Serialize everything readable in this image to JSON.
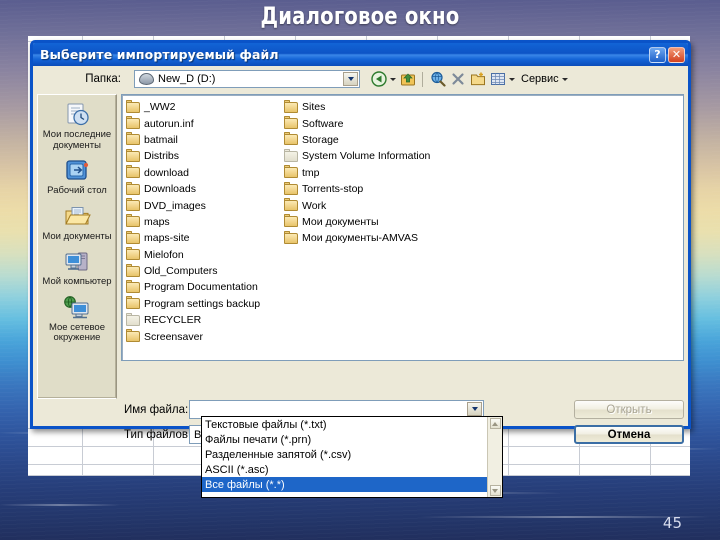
{
  "slide": {
    "title": "Диалоговое окно",
    "page_number": "45",
    "accent_color": "#0a53c8",
    "titlebar_color": "#0d54c6",
    "selection_color": "#1e66c8",
    "dialog_face_color": "#ece9d8"
  },
  "dialog": {
    "title": "Выберите импортируемый файл",
    "titlebar_buttons": [
      {
        "name": "help-button",
        "glyph": "?"
      },
      {
        "name": "close-button",
        "glyph": "✕"
      }
    ],
    "lookin": {
      "label": "Папка:",
      "value": "New_D (D:)",
      "icon": "drive-icon"
    },
    "toolbar": {
      "items": [
        {
          "name": "back-button",
          "icon": "back-arrow-icon"
        },
        {
          "name": "back-dropdown",
          "icon": "chevron-down-icon"
        },
        {
          "name": "up-one-level-button",
          "icon": "up-folder-icon"
        },
        {
          "name": "separator",
          "icon": "separator"
        },
        {
          "name": "search-button",
          "icon": "search-globe-icon"
        },
        {
          "name": "delete-button",
          "icon": "delete-x-icon"
        },
        {
          "name": "new-folder-button",
          "icon": "new-folder-icon"
        },
        {
          "name": "views-button",
          "icon": "views-grid-icon"
        },
        {
          "name": "views-dropdown",
          "icon": "chevron-down-icon"
        }
      ],
      "tools_label": "Сервис"
    },
    "places": [
      {
        "name": "my-recent-documents",
        "label": "Мои последние документы",
        "icon": "recent-documents-icon"
      },
      {
        "name": "desktop",
        "label": "Рабочий стол",
        "icon": "desktop-icon"
      },
      {
        "name": "my-documents",
        "label": "Мои документы",
        "icon": "my-documents-icon"
      },
      {
        "name": "my-computer",
        "label": "Мой компьютер",
        "icon": "my-computer-icon"
      },
      {
        "name": "my-network-places",
        "label": "Мое сетевое окружение",
        "icon": "network-places-icon"
      }
    ],
    "files": {
      "column1": [
        {
          "label": "_WW2",
          "type": "folder"
        },
        {
          "label": "autorun.inf",
          "type": "folder"
        },
        {
          "label": "batmail",
          "type": "folder"
        },
        {
          "label": "Distribs",
          "type": "folder"
        },
        {
          "label": "download",
          "type": "folder"
        },
        {
          "label": "Downloads",
          "type": "folder"
        },
        {
          "label": "DVD_images",
          "type": "folder"
        },
        {
          "label": "maps",
          "type": "folder"
        },
        {
          "label": "maps-site",
          "type": "folder"
        },
        {
          "label": "Mielofon",
          "type": "folder"
        },
        {
          "label": "Old_Computers",
          "type": "folder"
        },
        {
          "label": "Program Documentation",
          "type": "folder"
        },
        {
          "label": "Program settings backup",
          "type": "folder"
        },
        {
          "label": "RECYCLER",
          "type": "folder-hidden"
        },
        {
          "label": "Screensaver",
          "type": "folder"
        }
      ],
      "column2": [
        {
          "label": "Sites",
          "type": "folder"
        },
        {
          "label": "Software",
          "type": "folder"
        },
        {
          "label": "Storage",
          "type": "folder"
        },
        {
          "label": "System Volume Information",
          "type": "folder-hidden"
        },
        {
          "label": "tmp",
          "type": "folder"
        },
        {
          "label": "Torrents-stop",
          "type": "folder"
        },
        {
          "label": "Work",
          "type": "folder"
        },
        {
          "label": "Мои документы",
          "type": "folder"
        },
        {
          "label": "Мои документы-AMVAS",
          "type": "folder"
        }
      ]
    },
    "filename": {
      "label": "Имя файла:",
      "value": "",
      "placeholder": ""
    },
    "filetype": {
      "label": "Тип файлов:",
      "value": "Все файлы (*.*)",
      "options": [
        "Текстовые файлы (*.txt)",
        "Файлы печати (*.prn)",
        "Разделенные запятой (*.csv)",
        "ASCII (*.asc)",
        "Все файлы (*.*)"
      ],
      "selected_index": 4,
      "expanded": true
    },
    "buttons": {
      "open": {
        "label": "Открыть",
        "enabled": false
      },
      "cancel": {
        "label": "Отмена",
        "enabled": true,
        "default": true
      }
    }
  }
}
